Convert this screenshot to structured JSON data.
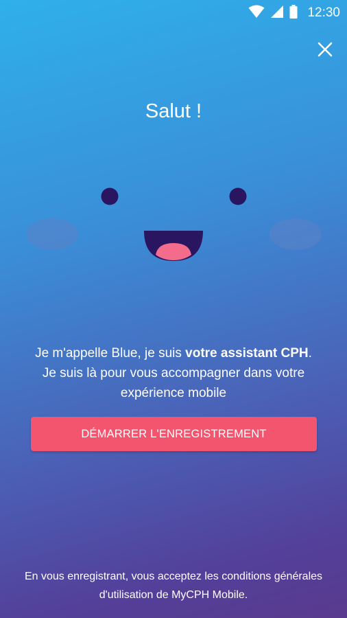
{
  "status_bar": {
    "time": "12:30",
    "icons": [
      "wifi-icon",
      "signal-icon",
      "battery-icon"
    ]
  },
  "header": {
    "close_icon": "close-icon"
  },
  "greeting": "Salut !",
  "intro": {
    "part1": "Je m'appelle Blue, je suis ",
    "bold": "votre assistant CPH",
    "part2": ". Je suis là pour vous accompagner dans votre expérience mobile"
  },
  "start_button_label": "DÉMARRER L'ENREGISTREMENT",
  "terms": "En vous enregistrant, vous acceptez les conditions générales d'utilisation de MyCPH Mobile.",
  "colors": {
    "gradient_top": "#2fb0ea",
    "gradient_bottom": "#5a3a8e",
    "button": "#f3546e",
    "face_dark": "#2a1560",
    "tongue": "#f46c8c"
  }
}
